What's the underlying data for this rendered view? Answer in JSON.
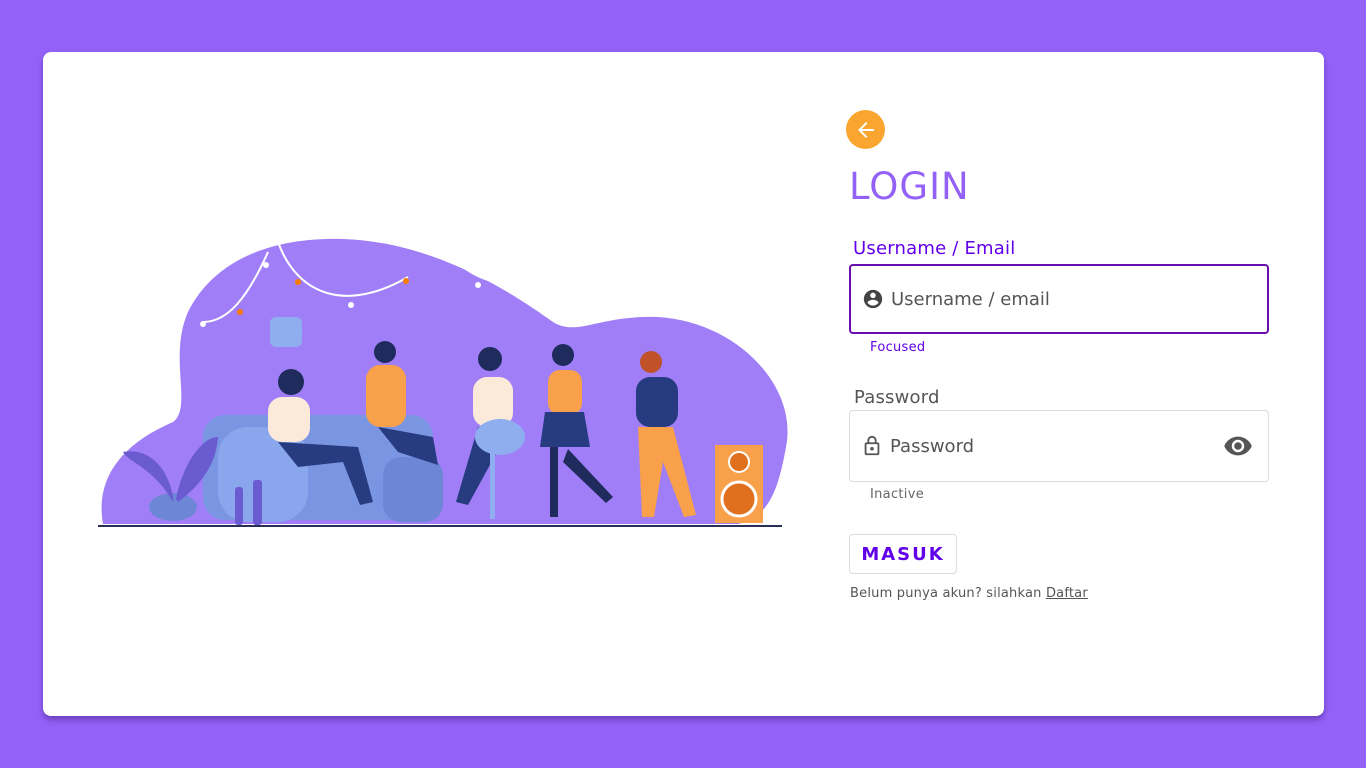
{
  "login": {
    "title": "LOGIN",
    "back_icon": "arrow-left-icon",
    "username": {
      "label": "Username / Email",
      "placeholder": "Username / email",
      "value": "",
      "helper": "Focused",
      "icon": "account-circle-icon"
    },
    "password": {
      "label": "Password",
      "placeholder": "Password",
      "value": "",
      "helper": "Inactive",
      "icon": "lock-icon",
      "toggle_icon": "eye-icon"
    },
    "submit_label": "MASUK",
    "register_prompt": "Belum punya akun? silahkan",
    "register_link": "Daftar"
  },
  "colors": {
    "background": "#9461f7",
    "accent": "#6200ea",
    "back_button": "#f9a530",
    "title": "#9461f7"
  }
}
